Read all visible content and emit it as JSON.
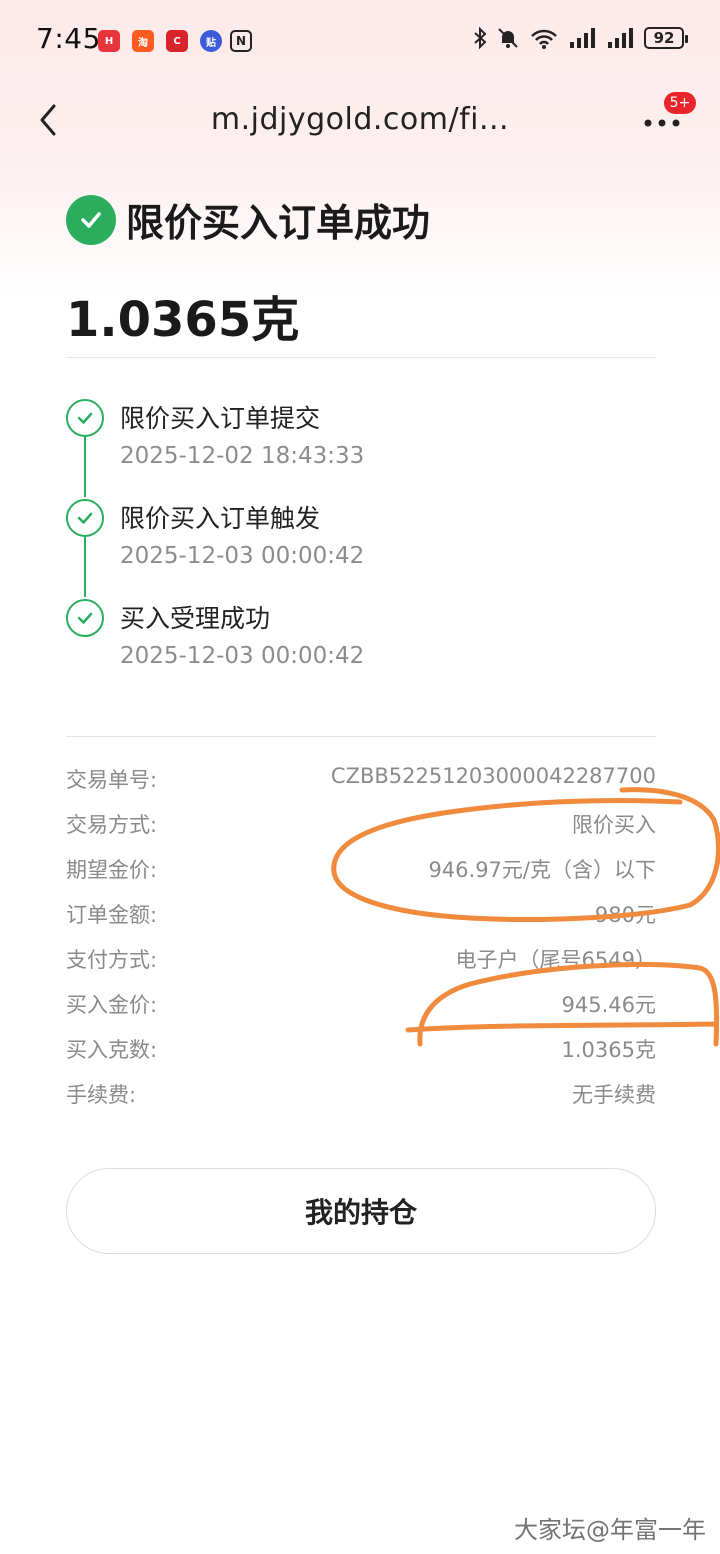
{
  "status_bar": {
    "time": "7:45",
    "battery": "92",
    "icons": [
      "huawei-app-icon",
      "taobao-app-icon",
      "shopping-app-icon",
      "tieba-app-icon",
      "nfc-icon",
      "bluetooth-icon",
      "mute-bell-icon",
      "wifi-icon",
      "signal-icon",
      "signal-icon",
      "battery-icon"
    ]
  },
  "nav": {
    "url": "m.jdjygold.com/fi...",
    "badge": "5+"
  },
  "header": {
    "title": "限价买入订单成功",
    "amount": "1.0365克",
    "accent_color": "#2aae5e"
  },
  "timeline": [
    {
      "label": "限价买入订单提交",
      "time": "2025-12-02 18:43:33"
    },
    {
      "label": "限价买入订单触发",
      "time": "2025-12-03 00:00:42"
    },
    {
      "label": "买入受理成功",
      "time": "2025-12-03 00:00:42"
    }
  ],
  "details": [
    {
      "label": "交易单号:",
      "value": "CZBB52251203000042287700"
    },
    {
      "label": "交易方式:",
      "value": "限价买入"
    },
    {
      "label": "期望金价:",
      "value": "946.97元/克（含）以下"
    },
    {
      "label": "订单金额:",
      "value": "980元"
    },
    {
      "label": "支付方式:",
      "value": "电子户（尾号6549）"
    },
    {
      "label": "买入金价:",
      "value": "945.46元"
    },
    {
      "label": "买入克数:",
      "value": "1.0365克"
    },
    {
      "label": "手续费:",
      "value": "无手续费"
    }
  ],
  "actions": {
    "holdings_button": "我的持仓"
  },
  "watermark": "大家坛@年富一年",
  "annotation_color": "#f08a3c"
}
